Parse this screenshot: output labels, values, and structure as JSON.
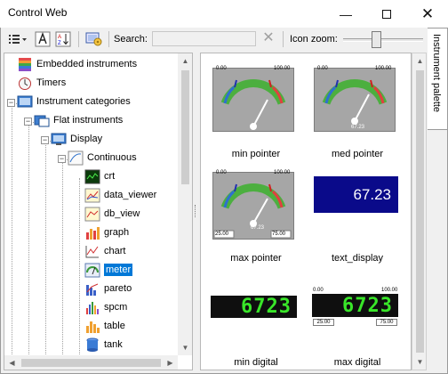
{
  "window": {
    "title": "Control Web",
    "minimize_icon": "minimize-icon",
    "maximize_icon": "maximize-icon",
    "close_icon": "close-icon"
  },
  "toolbar": {
    "search_label": "Search:",
    "search_value": "",
    "search_placeholder": "",
    "zoom_label": "Icon zoom:",
    "zoom_level": 0.4
  },
  "side_tab": {
    "label": "Instrument palette"
  },
  "tree": {
    "nodes": [
      {
        "label": "Embedded instruments",
        "icon": "embedded-instruments-icon"
      },
      {
        "label": "Timers",
        "icon": "timer-icon"
      },
      {
        "label": "Instrument categories",
        "icon": "instrument-categories-icon"
      },
      {
        "label": "Flat instruments",
        "icon": "flat-instruments-icon"
      },
      {
        "label": "Display",
        "icon": "display-icon"
      },
      {
        "label": "Continuous",
        "icon": "continuous-icon"
      },
      {
        "label": "crt",
        "icon": "crt-icon"
      },
      {
        "label": "data_viewer",
        "icon": "data-viewer-icon"
      },
      {
        "label": "db_view",
        "icon": "db-view-icon"
      },
      {
        "label": "graph",
        "icon": "graph-icon"
      },
      {
        "label": "chart",
        "icon": "chart-icon"
      },
      {
        "label": "meter",
        "icon": "meter-icon"
      },
      {
        "label": "pareto",
        "icon": "pareto-icon"
      },
      {
        "label": "spcm",
        "icon": "spcm-icon"
      },
      {
        "label": "table",
        "icon": "table-icon"
      },
      {
        "label": "tank",
        "icon": "tank-icon"
      }
    ],
    "selected": "meter"
  },
  "palette": {
    "items": [
      {
        "label": "min pointer"
      },
      {
        "label": "med pointer",
        "readout": "67.23"
      },
      {
        "label": "max pointer",
        "readout": "67.23",
        "min_value": "25.00",
        "max_value": "75.00"
      },
      {
        "label": "text_display",
        "value": "67.23"
      },
      {
        "label": "min digital",
        "value": "6723"
      },
      {
        "label": "max digital",
        "value": "6723",
        "top_left": "0.00",
        "top_right": "100.00",
        "bottom_left": "25.00",
        "bottom_right": "75.00"
      }
    ],
    "gauge_scale": {
      "min": "0.00",
      "max": "100.00"
    }
  },
  "colors": {
    "selection": "#0078d7",
    "text_display_bg": "#0a0a8a",
    "lcd_green": "#39e629"
  }
}
